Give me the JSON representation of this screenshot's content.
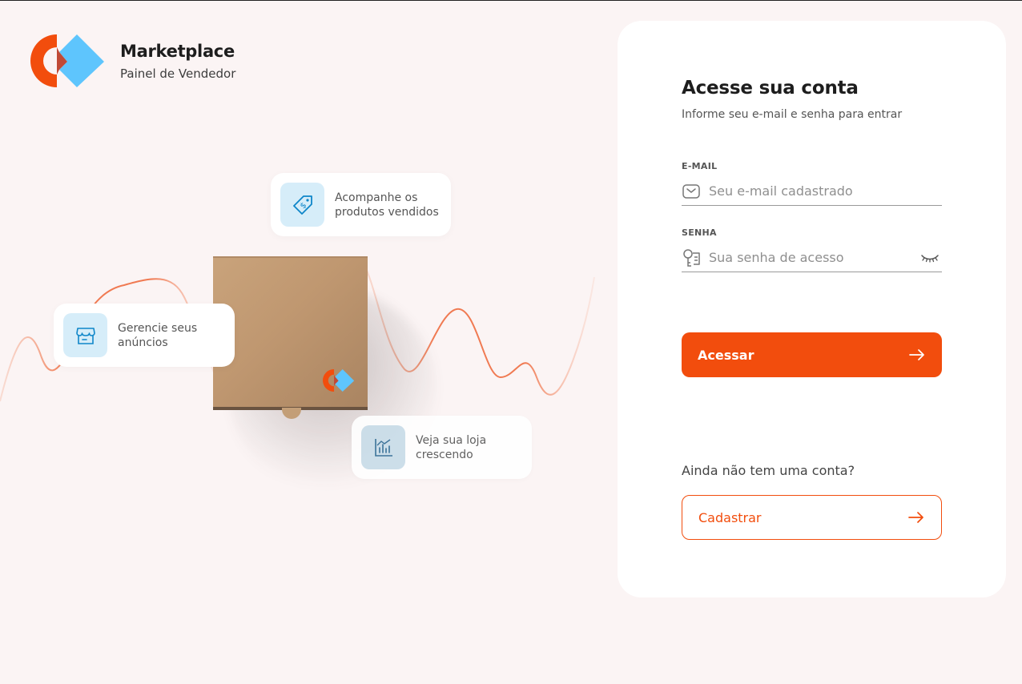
{
  "brand": {
    "title": "Marketplace",
    "subtitle": "Painel de Vendedor",
    "colors": {
      "orange": "#f24d0d",
      "blue": "#5ec5fd"
    }
  },
  "features": {
    "sales": {
      "label": "Acompanhe os\nprodutos vendidos",
      "icon": "price-tag-icon"
    },
    "ads": {
      "label": "Gerencie seus\nanúncios",
      "icon": "storefront-icon"
    },
    "growth": {
      "label": "Veja sua loja\ncrescendo",
      "icon": "bar-chart-icon"
    }
  },
  "login": {
    "title": "Acesse sua conta",
    "subtitle": "Informe seu e-mail e senha para entrar",
    "email": {
      "label": "E-MAIL",
      "placeholder": "Seu e-mail cadastrado",
      "value": "",
      "icon": "mail-icon"
    },
    "password": {
      "label": "SENHA",
      "placeholder": "Sua senha de acesso",
      "value": "",
      "icon": "key-icon",
      "toggle_icon": "eye-closed-icon"
    },
    "submit_label": "Acessar",
    "no_account_text": "Ainda não tem uma conta?",
    "register_label": "Cadastrar"
  },
  "theme": {
    "background": "#fbf4f4",
    "accent": "#f24d0d",
    "icon_tile": "#d6edf9"
  }
}
